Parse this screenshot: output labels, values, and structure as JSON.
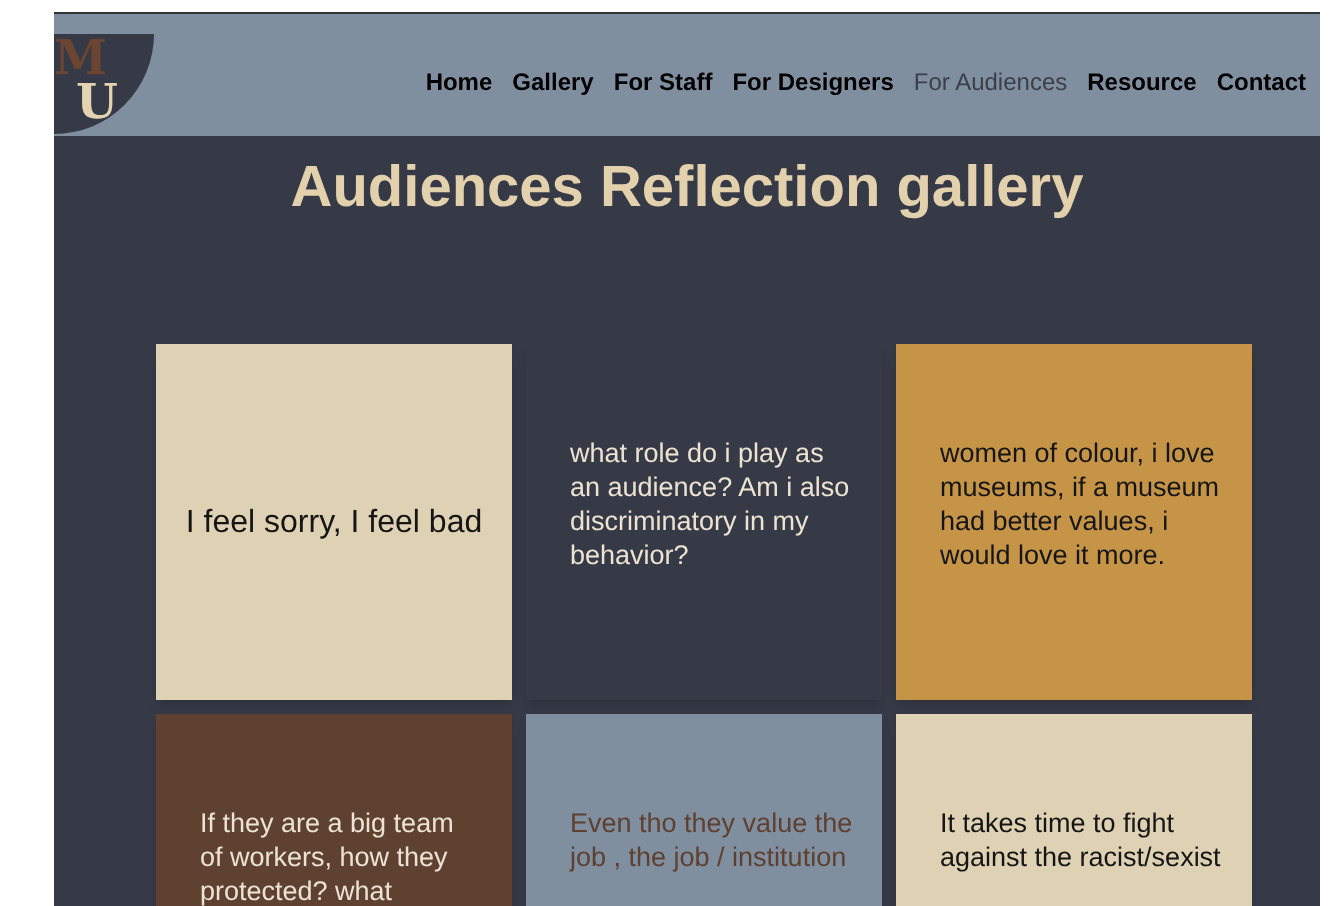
{
  "logo": {
    "letters": [
      "M",
      "U"
    ]
  },
  "nav": [
    {
      "label": "Home",
      "selected": false
    },
    {
      "label": "Gallery",
      "selected": false
    },
    {
      "label": "For Staff",
      "selected": false
    },
    {
      "label": "For Designers",
      "selected": false
    },
    {
      "label": "For Audiences",
      "selected": true
    },
    {
      "label": "Resource",
      "selected": false
    },
    {
      "label": "Contact",
      "selected": false
    }
  ],
  "title": "Audiences Reflection gallery",
  "cards": [
    {
      "lines": [
        "I feel sorry, I feel bad"
      ],
      "color": "#dfd1b3",
      "kind": "centered"
    },
    {
      "lines": [
        "what role do i play as",
        "an audience? Am i also",
        "discriminatory in my",
        "behavior?"
      ],
      "color": "#363a46",
      "kind": "note"
    },
    {
      "lines": [
        "women of colour, i love",
        "museums, if a museum",
        "had better values, i",
        "would love it more."
      ],
      "color": "#c69447",
      "kind": "note"
    },
    {
      "lines": [
        "If they are a big team",
        "of workers, how they",
        "protected? what"
      ],
      "color": "#5f4132",
      "kind": "note"
    },
    {
      "lines": [
        "Even tho they value the",
        "job , the job / institution"
      ],
      "color": "#808fa0",
      "kind": "note"
    },
    {
      "lines": [
        "It takes time to fight",
        "against the racist/sexist"
      ],
      "color": "#dfd1b3",
      "kind": "note"
    }
  ]
}
